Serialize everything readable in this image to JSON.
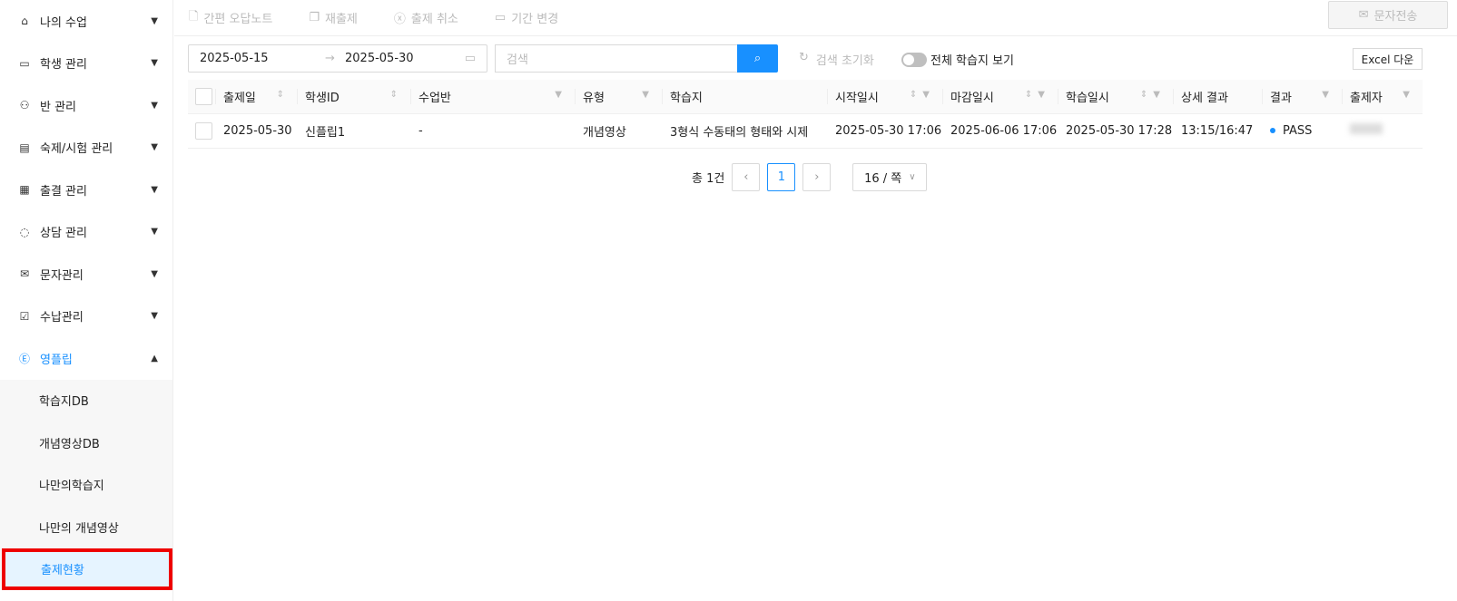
{
  "sidebar": {
    "items": [
      {
        "label": "나의 수업",
        "icon": "home-icon"
      },
      {
        "label": "학생 관리",
        "icon": "id-card-icon"
      },
      {
        "label": "반 관리",
        "icon": "users-icon"
      },
      {
        "label": "숙제/시험 관리",
        "icon": "document-icon"
      },
      {
        "label": "출결 관리",
        "icon": "calendar-icon"
      },
      {
        "label": "상담 관리",
        "icon": "chat-icon"
      },
      {
        "label": "문자관리",
        "icon": "mail-icon"
      },
      {
        "label": "수납관리",
        "icon": "inbox-check-icon"
      },
      {
        "label": "영플립",
        "icon": "e-box-icon"
      }
    ],
    "subitems": [
      "학습지DB",
      "개념영상DB",
      "나만의학습지",
      "나만의 개념영상",
      "출제현황"
    ]
  },
  "toolbar": {
    "quick_note": "간편 오답노트",
    "reassign": "재출제",
    "cancel": "출제 취소",
    "change_period": "기간 변경",
    "sms": "문자전송"
  },
  "filters": {
    "start_date": "2025-05-15",
    "end_date": "2025-05-30",
    "search_placeholder": "검색",
    "reset": "검색 초기화",
    "show_all": "전체 학습지 보기",
    "excel": "Excel 다운"
  },
  "table": {
    "headers": [
      "출제일",
      "학생ID",
      "수업반",
      "유형",
      "학습지",
      "시작일시",
      "마감일시",
      "학습일시",
      "상세 결과",
      "결과",
      "출제자"
    ],
    "rows": [
      [
        "2025-05-30",
        "신플립1",
        "-",
        "개념영상",
        "3형식 수동태의 형태와 시제",
        "2025-05-30 17:06",
        "2025-06-06 17:06",
        "2025-05-30 17:28",
        "13:15/16:47",
        "PASS",
        ""
      ]
    ]
  },
  "pagination": {
    "total": "총 1건",
    "current": "1",
    "page_size": "16 / 쪽"
  },
  "colors": {
    "accent": "#1890ff",
    "highlight": "#e00000"
  }
}
